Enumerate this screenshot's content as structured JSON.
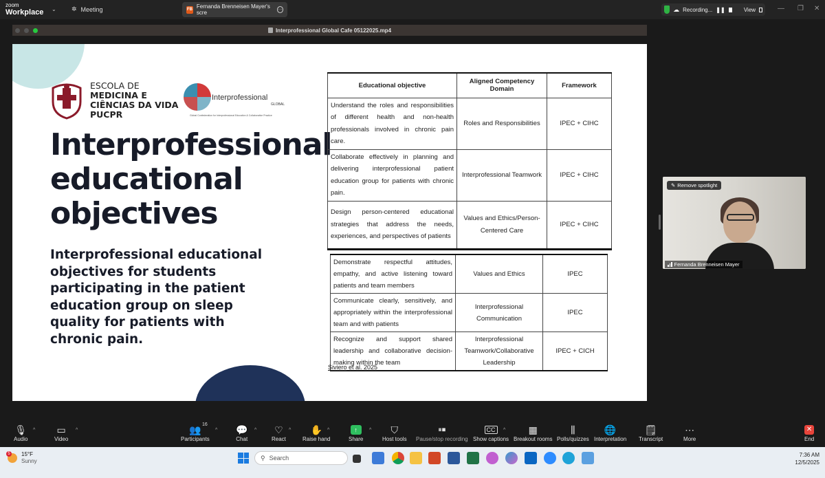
{
  "topbar": {
    "app_small": "zoom",
    "app_name": "Workplace",
    "meeting_tab": "Meeting",
    "share_tab_badge": "FB",
    "share_tab_label": "Fernanda Brenneisen Mayer's scre",
    "recording_label": "Recording...",
    "view_label": "View"
  },
  "share_window": {
    "file_title": "Interprofessional Global Cafe 05122025.mp4"
  },
  "slide": {
    "school_line1": "ESCOLA DE",
    "school_line2": "MEDICINA E",
    "school_line3": "CIÊNCIAS DA VIDA",
    "school_line4": "PUCPR",
    "ip_logo": "Interprofessional",
    "ip_global": "GLOBAL",
    "ip_sub": "Global Confederation for Interprofessional Education & Collaborative Practice",
    "title_line1": "Interprofessional",
    "title_line2": "educational",
    "title_line3": "objectives",
    "subtitle": "Interprofessional educational objectives for students participating in the patient education group on sleep quality for patients with chronic pain.",
    "table1": {
      "headers": [
        "Educational objective",
        "Aligned Competency Domain",
        "Framework"
      ],
      "rows": [
        [
          "Understand the roles and responsibilities of different health and non-health professionals involved in chronic pain care.",
          "Roles and Responsibilities",
          "IPEC + CIHC"
        ],
        [
          "Collaborate effectively in planning and delivering interprofessional patient education group for patients with chronic pain.",
          "Interprofessional Teamwork",
          "IPEC + CIHC"
        ],
        [
          "Design person-centered educational strategies that address the needs, experiences, and perspectives of patients",
          "Values and Ethics/Person-Centered Care",
          "IPEC + CIHC"
        ]
      ]
    },
    "table2": {
      "rows": [
        [
          "Demonstrate respectful attitudes, empathy, and active listening toward patients and team members",
          "Values and Ethics",
          "IPEC"
        ],
        [
          "Communicate clearly, sensitively, and appropriately within the interprofessional team and with patients",
          "Interprofessional Communication",
          "IPEC"
        ],
        [
          "Recognize and support shared leadership and collaborative decision-making within the team",
          "Interprofessional Teamwork/Collaborative Leadership",
          "IPEC + CICH"
        ]
      ]
    },
    "citation_author": "Siviero",
    "citation_rest": " et al. 2025"
  },
  "video_tile": {
    "remove_spotlight": "Remove spotlight",
    "participant_name": "Fernanda Brenneisen Mayer"
  },
  "toolbar": {
    "audio": "Audio",
    "video": "Video",
    "participants": "Participants",
    "participants_count": "16",
    "chat": "Chat",
    "react": "React",
    "raise_hand": "Raise hand",
    "share": "Share",
    "host_tools": "Host tools",
    "pause_stop": "Pause/stop recording",
    "show_captions": "Show captions",
    "breakout_rooms": "Breakout rooms",
    "polls": "Polls/quizzes",
    "interpretation": "Interpretation",
    "transcript": "Transcript",
    "more": "More",
    "end": "End"
  },
  "taskbar": {
    "temperature": "15°F",
    "weather": "Sunny",
    "weather_badge": "5",
    "search_placeholder": "Search",
    "time": "7:36 AM",
    "date": "12/5/2025"
  },
  "colors": {
    "accent_red": "#e8443b",
    "share_green": "#2fbf5f",
    "slide_navy": "#1f3259",
    "slide_teal": "#c8e6e6"
  }
}
